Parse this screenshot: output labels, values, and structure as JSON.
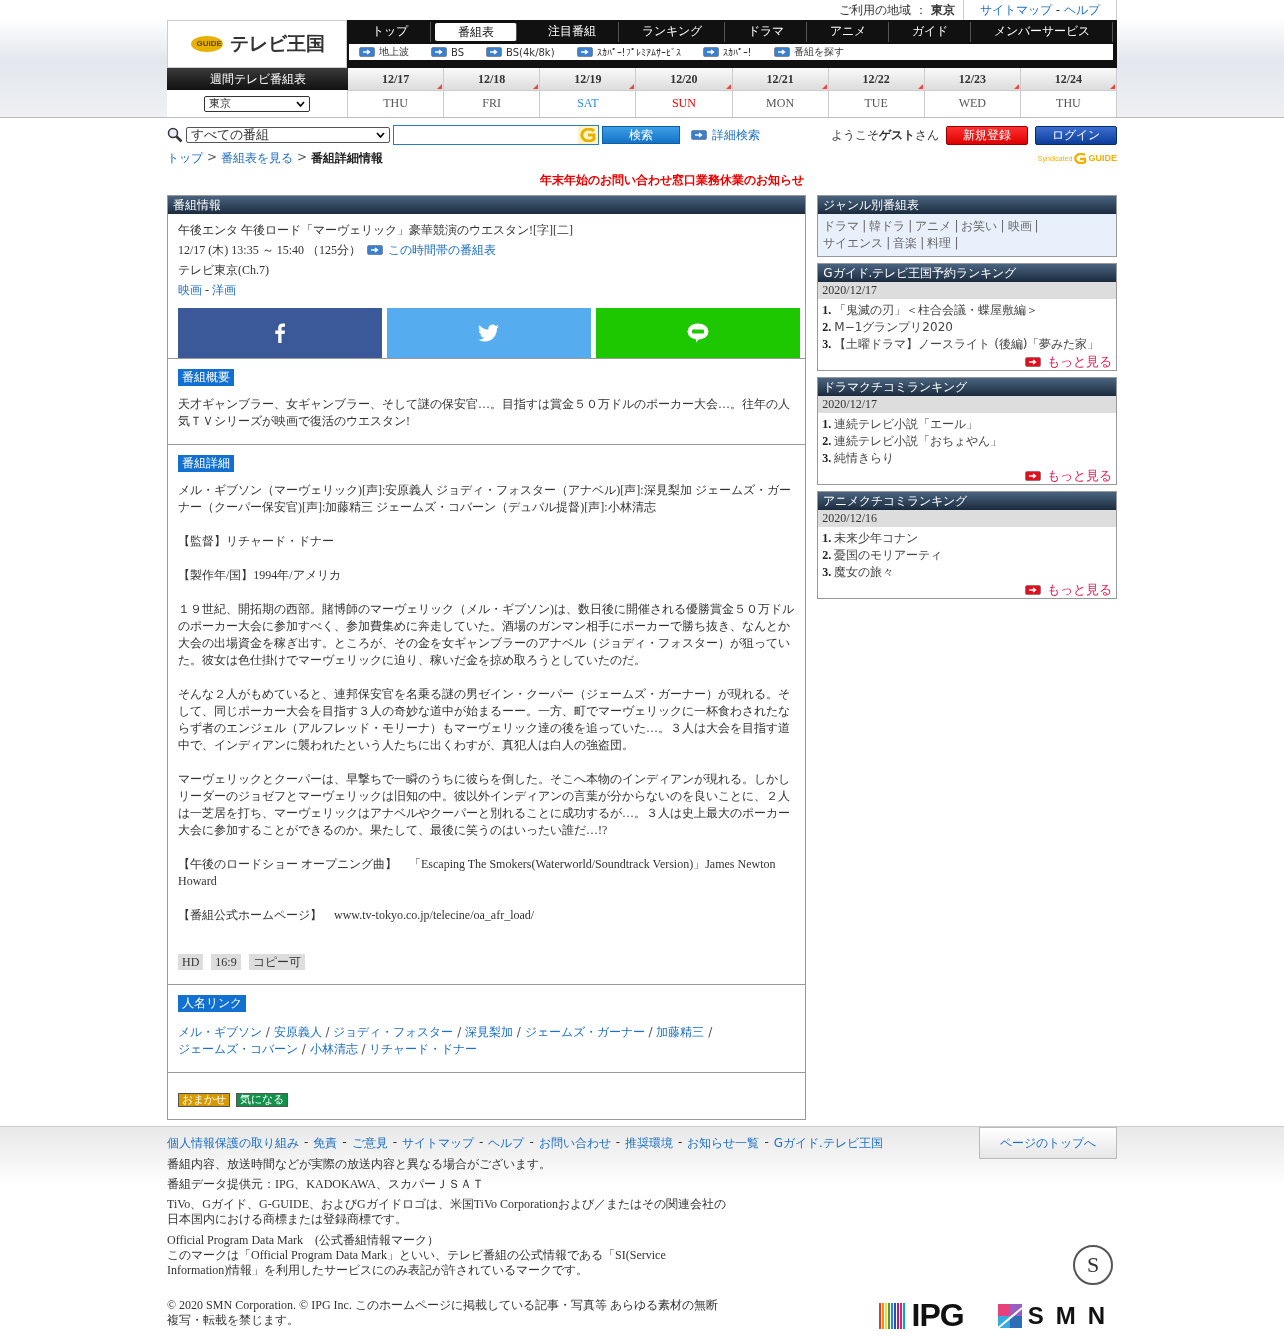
{
  "top_bar": {
    "region_label": "ご利用の地域 ：",
    "region": "東京",
    "links": [
      "サイトマップ",
      "ヘルプ"
    ],
    "separator": "-"
  },
  "logo": {
    "mark": "GUIDE",
    "text": "テレビ王国"
  },
  "nav": [
    {
      "label": "トップ",
      "selected": false
    },
    {
      "label": "番組表",
      "selected": true
    },
    {
      "label": "注目番組",
      "selected": false
    },
    {
      "label": "ランキング",
      "selected": false
    },
    {
      "label": "ドラマ",
      "selected": false
    },
    {
      "label": "アニメ",
      "selected": false
    },
    {
      "label": "ガイド",
      "selected": false
    },
    {
      "label": "メンバーサービス",
      "selected": false
    }
  ],
  "subnav": [
    "地上波",
    "BS",
    "BS(4k/8k)",
    "ｽｶﾊﾟｰ!ﾌﾟﾚﾐｱﾑｻｰﾋﾞｽ",
    "ｽｶﾊﾟｰ!",
    "番組を探す"
  ],
  "week": {
    "label": "週間テレビ番組表",
    "region": "東京",
    "days": [
      {
        "date": "12/17",
        "weekday": "THU",
        "kind": "weekday"
      },
      {
        "date": "12/18",
        "weekday": "FRI",
        "kind": "weekday"
      },
      {
        "date": "12/19",
        "weekday": "SAT",
        "kind": "saturday"
      },
      {
        "date": "12/20",
        "weekday": "SUN",
        "kind": "sunday"
      },
      {
        "date": "12/21",
        "weekday": "MON",
        "kind": "weekday"
      },
      {
        "date": "12/22",
        "weekday": "TUE",
        "kind": "weekday"
      },
      {
        "date": "12/23",
        "weekday": "WED",
        "kind": "weekday"
      },
      {
        "date": "12/24",
        "weekday": "THU",
        "kind": "weekday"
      }
    ]
  },
  "search": {
    "scope": "すべての番組",
    "button": "検索",
    "advanced": "詳細検索"
  },
  "account": {
    "welcome": "ようこそ",
    "user": "ゲスト",
    "suffix": "さん",
    "register": "新規登録",
    "login": "ログイン"
  },
  "syndicated": {
    "text": "Syndicated",
    "mark": "GUIDE"
  },
  "breadcrumb": {
    "links": [
      "トップ",
      "番組表を見る"
    ],
    "separator": ">",
    "current": "番組詳細情報"
  },
  "notice": "年末年始のお問い合わせ窓口業務休業のお知らせ",
  "program": {
    "header": "番組情報",
    "title": "午後エンタ 午後ロード「マーヴェリック」豪華競演のウエスタン![字][二]",
    "time": "12/17 (木) 13:35 ～ 15:40 （125分）",
    "schedule_link": "この時間帯の番組表",
    "channel": "テレビ東京(Ch.7)",
    "genres": [
      "映画",
      "洋画"
    ],
    "genre_separator": "-",
    "share": [
      {
        "kind": "facebook"
      },
      {
        "kind": "twitter"
      },
      {
        "kind": "line"
      }
    ]
  },
  "summary": {
    "label": "番組概要",
    "text": "天才ギャンブラー、女ギャンブラー、そして謎の保安官…。目指すは賞金５０万ドルのポーカー大会…。往年の人気ＴＶシリーズが映画で復活のウエスタン!"
  },
  "detail": {
    "label": "番組詳細",
    "paragraphs": [
      "メル・ギブソン（マーヴェリック)[声]:安原義人 ジョディ・フォスター（アナベル)[声]:深見梨加 ジェームズ・ガーナー（クーパー保安官)[声]:加藤精三 ジェームズ・コバーン（デュバル提督)[声]:小林清志",
      "【監督】リチャード・ドナー",
      "【製作年/国】1994年/アメリカ",
      "１９世紀、開拓期の西部。賭博師のマーヴェリック（メル・ギブソン)は、数日後に開催される優勝賞金５０万ドルのポーカー大会に参加すべく、参加費集めに奔走していた。酒場のガンマン相手にポーカーで勝ち抜き、なんとか大会の出場資金を稼ぎ出す。ところが、その金を女ギャンブラーのアナベル（ジョディ・フォスター）が狙っていた。彼女は色仕掛けでマーヴェリックに迫り、稼いだ金を掠め取ろうとしていたのだ。",
      "そんな２人がもめていると、連邦保安官を名乗る謎の男ゼイン・クーパー（ジェームズ・ガーナー）が現れる。そして、同じポーカー大会を目指す３人の奇妙な道中が始まるーー。一方、町でマーヴェリックに一杯食わされたならず者のエンジェル（アルフレッド・モリーナ）もマーヴェリック達の後を追っていた…。３人は大会を目指す道中で、インディアンに襲われたという人たちに出くわすが、真犯人は白人の強盗団。",
      "マーヴェリックとクーパーは、早撃ちで一瞬のうちに彼らを倒した。そこへ本物のインディアンが現れる。しかしリーダーのジョゼフとマーヴェリックは旧知の中。彼以外インディアンの言葉が分からないのを良いことに、２人は一芝居を打ち、マーヴェリックはアナベルやクーパーと別れることに成功するが…。３人は史上最大のポーカー大会に参加することができるのか。果たして、最後に笑うのはいったい誰だ…!?",
      "【午後のロードショー オープニング曲】　「Escaping The Smokers(Waterworld/Soundtrack Version)」James Newton Howard",
      "【番組公式ホームページ】　www.tv-tokyo.co.jp/telecine/oa_afr_load/"
    ],
    "tags": [
      "HD",
      "16:9",
      "コピー可"
    ]
  },
  "people": {
    "label": "人名リンク",
    "separator": "/",
    "names": [
      "メル・ギブソン",
      "安原義人",
      "ジョディ・フォスター",
      "深見梨加",
      "ジェームズ・ガーナー",
      "加藤精三",
      "ジェームズ・コバーン",
      "小林清志",
      "リチャード・ドナー"
    ]
  },
  "actions": [
    {
      "label": "おまかせ",
      "kind": "omakase"
    },
    {
      "label": "気になる",
      "kind": "kininaru"
    }
  ],
  "genre_panel": {
    "title": "ジャンル別番組表",
    "separator": "|",
    "items": [
      "ドラマ",
      "韓ドラ",
      "アニメ",
      "お笑い",
      "映画",
      "サイエンス",
      "音楽",
      "料理"
    ]
  },
  "rankings": [
    {
      "title": "Gガイド.テレビ王国予約ランキング",
      "date": "2020/12/17",
      "more": "もっと見る",
      "items": [
        {
          "rank": "1.",
          "text": "「鬼滅の刃」＜柱合会議・蝶屋敷編＞"
        },
        {
          "rank": "2.",
          "text": "M−1グランプリ2020"
        },
        {
          "rank": "3.",
          "text": "【土曜ドラマ】ノースライト (後編)「夢みた家」"
        }
      ]
    },
    {
      "title": "ドラマクチコミランキング",
      "date": "2020/12/17",
      "more": "もっと見る",
      "items": [
        {
          "rank": "1.",
          "text": "連続テレビ小説「エール」"
        },
        {
          "rank": "2.",
          "text": "連続テレビ小説「おちょやん」"
        },
        {
          "rank": "3.",
          "text": "純情きらり"
        }
      ]
    },
    {
      "title": "アニメクチコミランキング",
      "date": "2020/12/16",
      "more": "もっと見る",
      "items": [
        {
          "rank": "1.",
          "text": "未来少年コナン"
        },
        {
          "rank": "2.",
          "text": "憂国のモリアーティ"
        },
        {
          "rank": "3.",
          "text": "魔女の旅々"
        }
      ]
    }
  ],
  "footer": {
    "links": [
      "個人情報保護の取り組み",
      "免責",
      "ご意見",
      "サイトマップ",
      "ヘルプ",
      "お問い合わせ",
      "推奨環境",
      "お知らせ一覧",
      "Gガイド.テレビ王国"
    ],
    "separator": "-",
    "page_top": "ページのトップへ",
    "notes": [
      "番組内容、放送時間などが実際の放送内容と異なる場合がございます。",
      "番組データ提供元：IPG、KADOKAWA、スカパーＪＳＡＴ",
      "TiVo、Gガイド、G-GUIDE、およびGガイドロゴは、米国TiVo Corporationおよび／またはその関連会社の日本国内における商標または登録商標です。",
      "Official Program Data Mark　(公式番組情報マーク）",
      "このマークは「Official Program Data Mark」といい、テレビ番組の公式情報である「SI(Service Information)情報」を利用したサービスにのみ表記が許されているマークです。"
    ],
    "copyright": "© 2020 SMN Corporation. © IPG Inc. このホームページに掲載している記事・写真等 あらゆる素材の無断複写・転載を禁じます。",
    "seal": "S",
    "logos": [
      "IPG",
      "SMN"
    ]
  }
}
